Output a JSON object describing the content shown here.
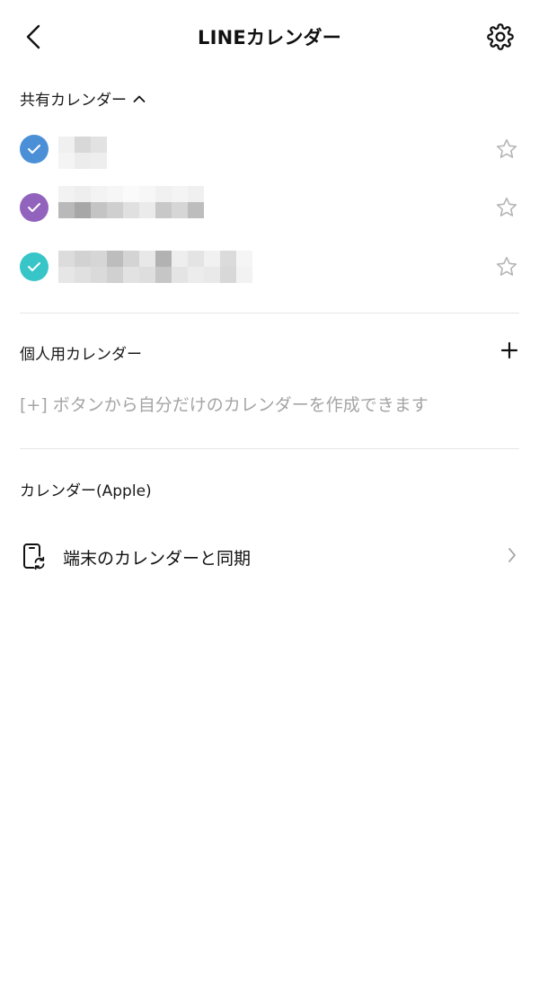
{
  "header": {
    "title": "LINEカレンダー",
    "back_icon": "chevron-left-icon",
    "settings_icon": "gear-icon"
  },
  "shared": {
    "heading": "共有カレンダー",
    "expanded_icon": "chevron-up-icon",
    "items": [
      {
        "color": "#4b90d6",
        "checked": true,
        "favorite": false
      },
      {
        "color": "#9263bd",
        "checked": true,
        "favorite": false
      },
      {
        "color": "#37c5c8",
        "checked": true,
        "favorite": false
      }
    ]
  },
  "personal": {
    "heading": "個人用カレンダー",
    "add_icon": "plus-icon",
    "empty_hint": "[+] ボタンから自分だけのカレンダーを作成できます"
  },
  "device": {
    "heading": "カレンダー(Apple)",
    "sync_label": "端末のカレンダーと同期",
    "sync_icon": "phone-sync-icon",
    "chevron_icon": "chevron-right-icon"
  },
  "colors": {
    "text": "#111111",
    "muted": "#a5a5a5",
    "divider": "#e6e6e6",
    "icon_gray": "#b5b5b5"
  }
}
